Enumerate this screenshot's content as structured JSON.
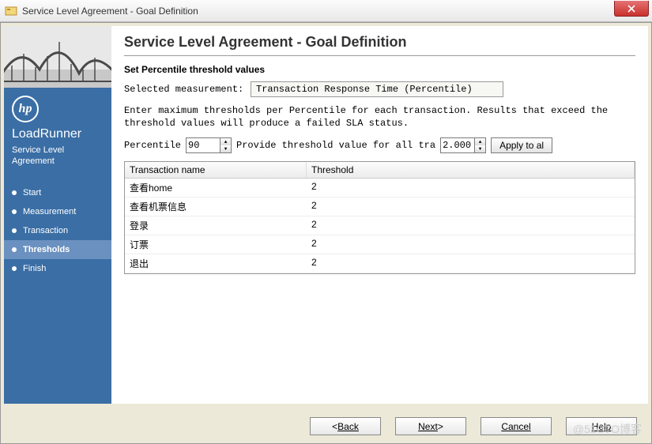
{
  "window": {
    "title": "Service Level Agreement - Goal Definition"
  },
  "sidebar": {
    "product": "LoadRunner",
    "subproduct": "Service Level Agreement",
    "logo_text": "hp",
    "steps": [
      {
        "label": "Start"
      },
      {
        "label": "Measurement"
      },
      {
        "label": "Transaction"
      },
      {
        "label": "Thresholds",
        "active": true
      },
      {
        "label": "Finish"
      }
    ]
  },
  "content": {
    "page_title": "Service Level Agreement - Goal Definition",
    "section_title": "Set Percentile threshold values",
    "selected_label": "Selected measurement:",
    "selected_value": "Transaction Response Time (Percentile)",
    "instructions": "Enter maximum thresholds per Percentile for each transaction. Results that exceed the threshold values will produce a failed SLA status.",
    "percentile_label": "Percentile",
    "percentile_value": "90",
    "provide_label": "Provide threshold value for all tra",
    "threshold_value": "2.000",
    "apply_label": "Apply to al",
    "table": {
      "headers": {
        "name": "Transaction name",
        "threshold": "Threshold"
      },
      "rows": [
        {
          "name": "查看home",
          "threshold": "2"
        },
        {
          "name": "查看机票信息",
          "threshold": "2"
        },
        {
          "name": "登录",
          "threshold": "2"
        },
        {
          "name": "订票",
          "threshold": "2"
        },
        {
          "name": "退出",
          "threshold": "2"
        }
      ]
    }
  },
  "buttons": {
    "back": "Back",
    "next": "Next",
    "cancel": "Cancel",
    "help": "Help"
  },
  "watermark": "@51CTO博客"
}
